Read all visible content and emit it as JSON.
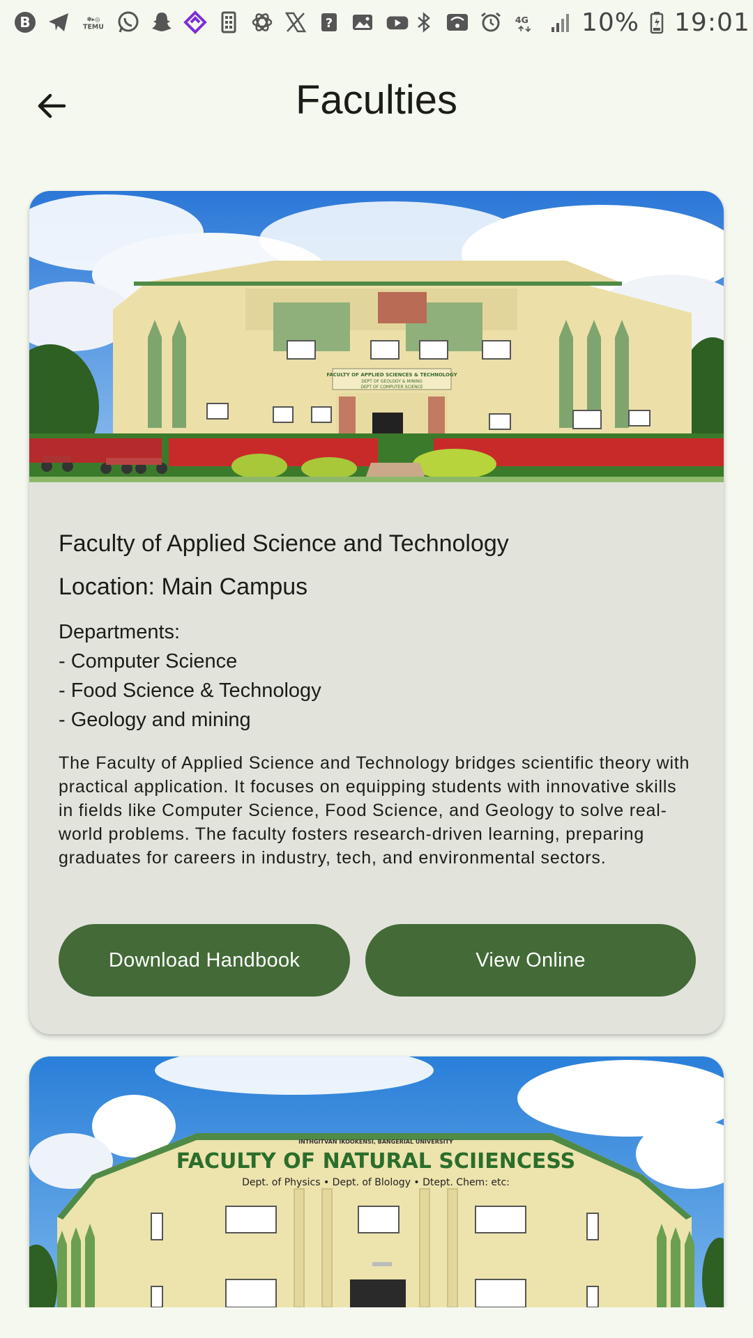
{
  "status_bar": {
    "battery_percent": "10%",
    "time": "19:01",
    "network": "4G",
    "left_icons": [
      "b-app-icon",
      "telegram-icon",
      "temu-icon",
      "whatsapp-icon",
      "snapchat-icon",
      "purple-app-icon",
      "sim-toolkit-icon",
      "chatgpt-icon",
      "x-icon",
      "question-app-icon",
      "gallery-icon",
      "youtube-icon"
    ],
    "right_icons": [
      "bluetooth-icon",
      "wifi-calling-icon",
      "alarm-icon",
      "signal-icon",
      "battery-icon"
    ],
    "temu_label": "TEMU"
  },
  "app_bar": {
    "title": "Faculties",
    "back_icon": "arrow-left-icon"
  },
  "faculties": [
    {
      "name": "Faculty of Applied Science and Technology",
      "location": "Location: Main Campus",
      "departments_heading": "Departments:",
      "departments": [
        "- Computer Science",
        "- Food Science & Technology",
        "- Geology and mining"
      ],
      "description": "The Faculty of Applied Science and Technology bridges scientific theory with practical application. It focuses on equipping students with innovative skills in fields like Computer Science, Food Science, and Geology to solve real-world problems. The faculty fosters research-driven learning, preparing graduates for careers in industry, tech, and environmental sectors.",
      "download_label": "Download Handbook",
      "view_label": "View Online",
      "image_sign_lines": [
        "FACULTY OF APPLIED SCIENCES & TECHNOLOGY",
        "DEPT OF GEOLOGY & MINING",
        "DEPT OF COMPUTER SCIENCE"
      ]
    },
    {
      "image_sign_small": "INTHGITVAN IKOOKENSI, BANGERIAL UNIVERSITY",
      "image_sign_title": "FACULTY OF NATURAL SCIIENCESS",
      "image_sign_depts": "Dept. of Physics • Dept. of Blology • Dtept. Chem: etc:"
    }
  ],
  "colors": {
    "background": "#f5f8ef",
    "card": "#e2e4dc",
    "primary_button": "#436a37",
    "button_text": "#ffffff"
  }
}
